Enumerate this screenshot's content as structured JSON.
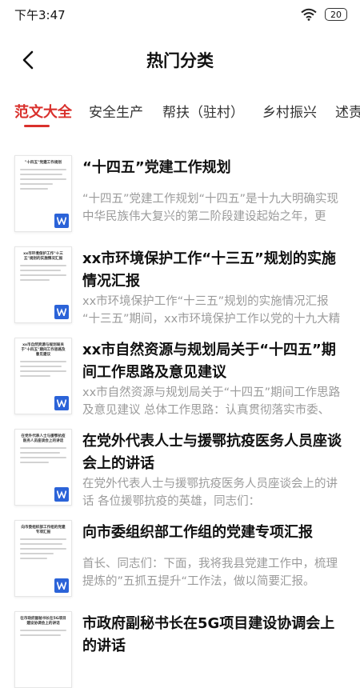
{
  "status_bar": {
    "time": "下午3:47",
    "battery": "20"
  },
  "header": {
    "title": "热门分类"
  },
  "tabs": [
    {
      "label": "范文大全"
    },
    {
      "label": "安全生产"
    },
    {
      "label": "帮扶（驻村）"
    },
    {
      "label": "乡村振兴"
    },
    {
      "label": "述责"
    }
  ],
  "items": [
    {
      "thumb_title": "\"十四五\"党建工作规划",
      "title": "“十四五”党建工作规划",
      "desc": "“十四五”党建工作规划“十四五”是十九大明确实现中华民族伟大复兴的第二阶段建设起始之年，更是…"
    },
    {
      "thumb_title": "xx市环境保护工作\"十三五\"规划的实施情况汇报",
      "title": "xx市环境保护工作“十三五”规划的实施情况汇报",
      "desc": "xx市环境保护工作“十三五”规划的实施情况汇报 “十三五”期间，xx市环境保护工作以党的十九大精神"
    },
    {
      "thumb_title": "xx市自然资源与规划局关于\"十四五\"期间工作思路及意见建议",
      "title": "xx市自然资源与规划局关于“十四五”期间工作思路及意见建议",
      "desc": "xx市自然资源与规划局关于“十四五”期间工作思路及意见建议 总体工作思路：认真贯彻落实市委、市…"
    },
    {
      "thumb_title": "在党外代表人士与援鄂抗疫医务人员座谈会上的讲话",
      "title": "在党外代表人士与援鄂抗疫医务人员座谈会上的讲话",
      "desc": "在党外代表人士与援鄂抗疫医务人员座谈会上的讲话 各位援鄂抗疫的英雄，同志们："
    },
    {
      "thumb_title": "向市委组织部工作组的党建专项汇报",
      "title": "向市委组织部工作组的党建专项汇报",
      "desc": "首长、同志们：下面，我将我县党建工作中，梳理提炼的”五抓五提升“工作法，做以简要汇报。"
    },
    {
      "thumb_title": "在市政府副秘书长在5G项目建设协调会上的讲话",
      "title": "市政府副秘书长在5G项目建设协调会上的讲话",
      "desc": ""
    }
  ],
  "colors": {
    "accent": "#d9302c",
    "word_blue": "#2b63d8"
  }
}
